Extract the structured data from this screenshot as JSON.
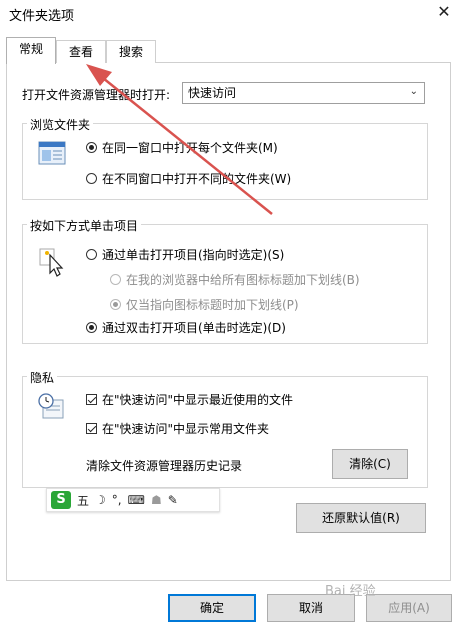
{
  "window": {
    "title": "文件夹选项",
    "close_glyph": "✕"
  },
  "tabs": [
    {
      "label": "常规",
      "active": true
    },
    {
      "label": "查看",
      "active": false
    },
    {
      "label": "搜索",
      "active": false
    }
  ],
  "open_explorer": {
    "label": "打开文件资源管理器时打开:",
    "value": "快速访问"
  },
  "browse_folders": {
    "title": "浏览文件夹",
    "options": [
      {
        "label": "在同一窗口中打开每个文件夹(M)",
        "selected": true
      },
      {
        "label": "在不同窗口中打开不同的文件夹(W)",
        "selected": false
      }
    ]
  },
  "click_items": {
    "title": "按如下方式单击项目",
    "single_click": {
      "label": "通过单击打开项目(指向时选定)(S)",
      "selected": false
    },
    "underline_all": {
      "label": "在我的浏览器中给所有图标标题加下划线(B)",
      "selected": false
    },
    "underline_hover": {
      "label": "仅当指向图标标题时加下划线(P)",
      "selected": true
    },
    "double_click": {
      "label": "通过双击打开项目(单击时选定)(D)",
      "selected": true
    }
  },
  "privacy": {
    "title": "隐私",
    "show_recent_files": {
      "label": "在\"快速访问\"中显示最近使用的文件",
      "checked": true
    },
    "show_frequent_folders": {
      "label": "在\"快速访问\"中显示常用文件夹",
      "checked": true
    },
    "clear_history_label": "清除文件资源管理器历史记录",
    "clear_button": "清除(C)"
  },
  "restore_defaults": "还原默认值(R)",
  "footer": {
    "ok": "确定",
    "cancel": "取消",
    "apply": "应用(A)"
  },
  "ime_toolbar": {
    "logo": "S",
    "mode": "五",
    "moon": "☽",
    "punct": "°,",
    "keyboard": "⌨",
    "user": "☗",
    "tools": "✎"
  },
  "watermark": "Bai 经验",
  "colors": {
    "arrow": "#d9534f",
    "primary_border": "#0078d7",
    "ime_green": "#2aa637"
  }
}
